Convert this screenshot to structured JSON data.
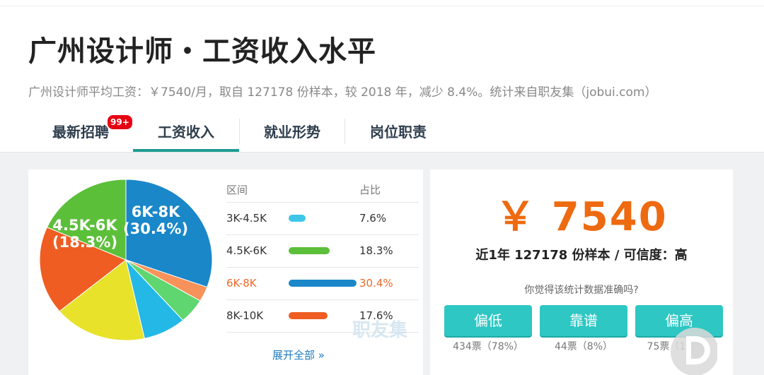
{
  "header": {
    "title": "广州设计师・工资收入水平",
    "subtitle": "广州设计师平均工资：￥7540/月，取自 127178 份样本，较 2018 年，减少 8.4%。统计来自职友集（jobui.com）"
  },
  "tabs": [
    {
      "label": "最新招聘",
      "badge": "99+"
    },
    {
      "label": "工资收入",
      "active": true
    },
    {
      "label": "就业形势"
    },
    {
      "label": "岗位职责"
    }
  ],
  "chart_data": {
    "type": "pie",
    "slices": [
      {
        "label": "6K-8K",
        "value": 30.4,
        "color": "#1a87c9"
      },
      {
        "label": "",
        "value": 3.0,
        "color": "#f7925a"
      },
      {
        "label": "",
        "value": 5.0,
        "color": "#5fd66f"
      },
      {
        "label": "",
        "value": 8.0,
        "color": "#23b8e6"
      },
      {
        "label": "",
        "value": 17.4,
        "color": "#e8e22a"
      },
      {
        "label": "8K-10K",
        "value": 17.6,
        "color": "#ef5d22"
      },
      {
        "label": "4.5K-6K",
        "value": 18.3,
        "color": "#5cbf3a"
      }
    ],
    "pie_labels": [
      {
        "range": "6K-8K",
        "pct": "(30.4%)"
      },
      {
        "range": "4.5K-6K",
        "pct": "(18.3%)"
      }
    ]
  },
  "legend": {
    "col_range": "区间",
    "col_pct": "占比",
    "rows": [
      {
        "range": "3K-4.5K",
        "pct": "7.6%",
        "pct_value": 7.6,
        "color": "#3ec6e8"
      },
      {
        "range": "4.5K-6K",
        "pct": "18.3%",
        "pct_value": 18.3,
        "color": "#5cbf3a"
      },
      {
        "range": "6K-8K",
        "pct": "30.4%",
        "pct_value": 30.4,
        "color": "#1a87c9",
        "highlight": true
      },
      {
        "range": "8K-10K",
        "pct": "17.6%",
        "pct_value": 17.6,
        "color": "#ef5d22"
      }
    ],
    "expand": "展开全部 »"
  },
  "watermark": "职友集",
  "summary": {
    "salary": "￥ 7540",
    "sample_line": "近1年 127178 份样本 / 可信度：高",
    "question": "你觉得该统计数据准确吗?",
    "votes": [
      {
        "label": "偏低",
        "count": "434票（78%）"
      },
      {
        "label": "靠谱",
        "count": "44票（8%）"
      },
      {
        "label": "偏高",
        "count": "75票（14%）"
      }
    ]
  }
}
